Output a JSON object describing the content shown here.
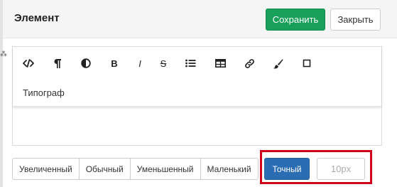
{
  "modal": {
    "title": "Элемент",
    "save_label": "Сохранить",
    "close_label": "Закрыть"
  },
  "toolbar": {
    "tools": [
      {
        "icon": "code-view-icon"
      },
      {
        "icon": "paragraph-icon"
      },
      {
        "icon": "contrast-icon"
      },
      {
        "icon": "bold-icon",
        "text": "B"
      },
      {
        "icon": "italic-icon",
        "text": "I"
      },
      {
        "icon": "strikethrough-icon",
        "text": "S"
      },
      {
        "icon": "bullet-list-icon"
      },
      {
        "icon": "table-icon"
      },
      {
        "icon": "link-icon"
      },
      {
        "icon": "brush-icon"
      },
      {
        "icon": "square-icon"
      }
    ],
    "dropdown_label": "Типограф"
  },
  "size_options": {
    "options": [
      "Увеличенный",
      "Обычный",
      "Уменьшенный",
      "Маленький"
    ],
    "active": "Точный",
    "input_placeholder": "10px"
  },
  "colors": {
    "save": "#18a05a",
    "active": "#2b6db2",
    "highlight": "#d0021b"
  }
}
